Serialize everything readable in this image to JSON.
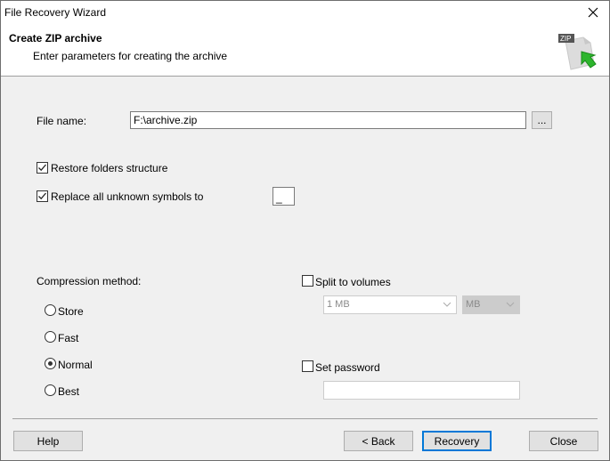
{
  "window": {
    "title": "File Recovery Wizard",
    "close_icon": "close-icon"
  },
  "header": {
    "title": "Create ZIP archive",
    "subtitle": "Enter parameters for creating the archive",
    "icon_badge": "ZIP",
    "icon": "zip-archive-recovery-icon"
  },
  "form": {
    "file_name_label": "File name:",
    "file_name_value": "F:\\archive.zip",
    "browse_label": "...",
    "restore_folders": {
      "label": "Restore folders structure",
      "checked": true
    },
    "replace_unknown": {
      "label": "Replace all unknown symbols to",
      "checked": true,
      "value": "_"
    }
  },
  "compression": {
    "label": "Compression method:",
    "options": [
      {
        "label": "Store",
        "selected": false
      },
      {
        "label": "Fast",
        "selected": false
      },
      {
        "label": "Normal",
        "selected": true
      },
      {
        "label": "Best",
        "selected": false
      }
    ]
  },
  "split": {
    "label": "Split to volumes",
    "checked": false,
    "size_value": "1 MB",
    "unit_value": "MB"
  },
  "password": {
    "label": "Set password",
    "checked": false,
    "value": ""
  },
  "footer": {
    "help_label": "Help",
    "back_label": "< Back",
    "recovery_label": "Recovery",
    "close_label": "Close"
  }
}
